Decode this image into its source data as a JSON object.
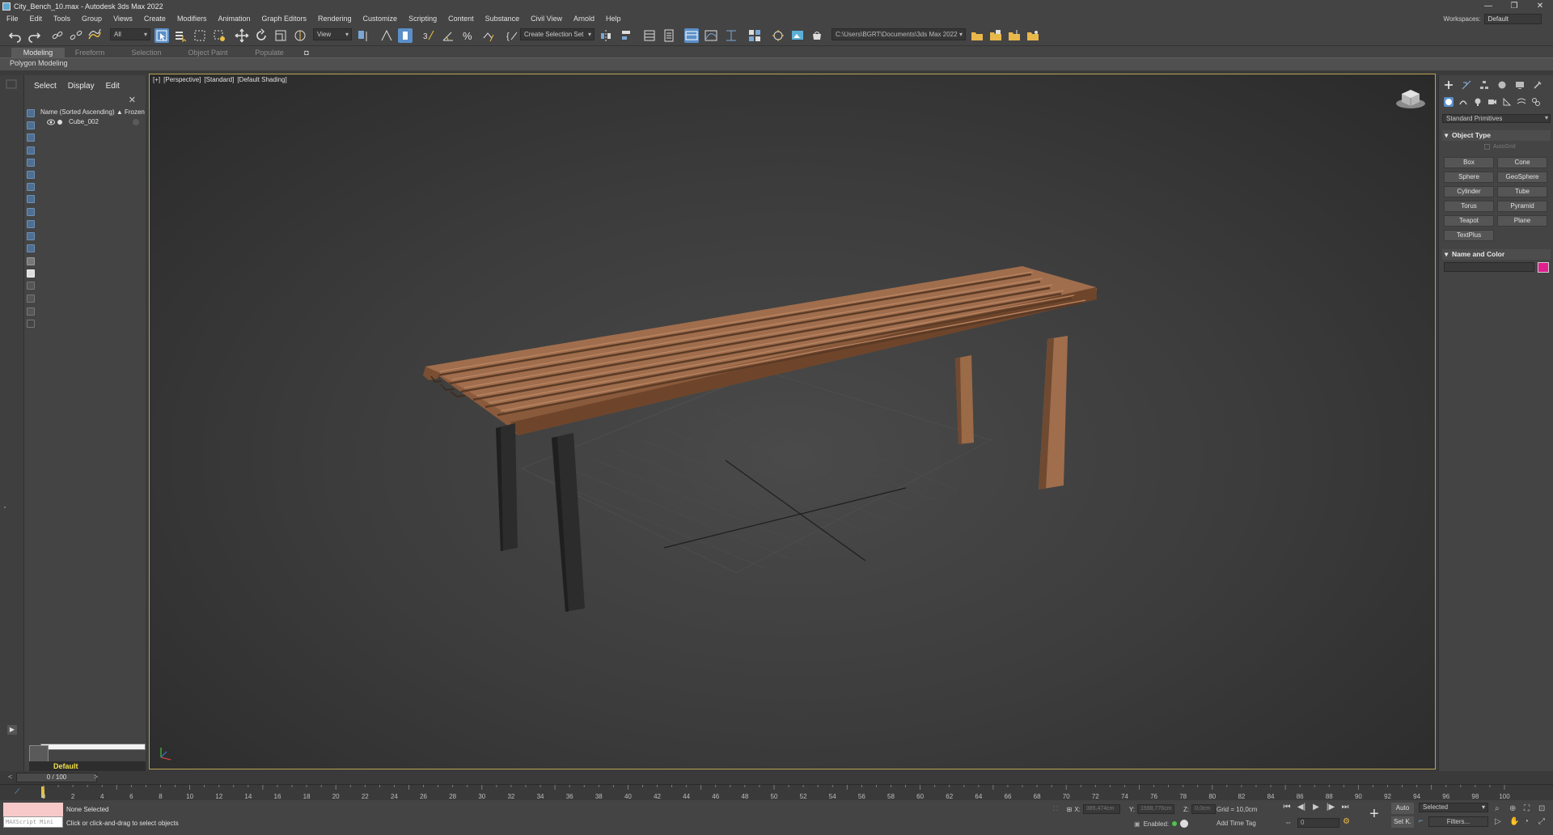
{
  "window": {
    "title": "City_Bench_10.max - Autodesk 3ds Max 2022",
    "controls": [
      "—",
      "❐",
      "✕"
    ]
  },
  "menu": [
    "File",
    "Edit",
    "Tools",
    "Group",
    "Views",
    "Create",
    "Modifiers",
    "Animation",
    "Graph Editors",
    "Rendering",
    "Customize",
    "Scripting",
    "Content",
    "Substance",
    "Civil View",
    "Arnold",
    "Help"
  ],
  "workspace": {
    "label": "Workspaces:",
    "value": "Default"
  },
  "toolbar": {
    "filter_value": "All",
    "refcoord_value": "View",
    "selection_set_placeholder": "Create Selection Set",
    "project_path": "C:\\Users\\BGRT\\Documents\\3ds Max 2022"
  },
  "ribbon": {
    "tabs": [
      "Modeling",
      "Freeform",
      "Selection",
      "Object Paint",
      "Populate"
    ],
    "active_tab": "Modeling",
    "panel_label": "Polygon Modeling"
  },
  "scene_explorer": {
    "tabs": [
      "Select",
      "Display",
      "Edit"
    ],
    "header": "Name (Sorted Ascending) ▲ Frozen",
    "objects": [
      {
        "name": "Cube_002"
      }
    ],
    "layer": "Default"
  },
  "viewport": {
    "labels": [
      "+",
      "Perspective",
      "Standard",
      "Default Shading"
    ]
  },
  "command_panel": {
    "dropdown": "Standard Primitives",
    "object_type_title": "Object Type",
    "autogrid": "AutoGrid",
    "primitives": [
      "Box",
      "Cone",
      "Sphere",
      "GeoSphere",
      "Cylinder",
      "Tube",
      "Torus",
      "Pyramid",
      "Teapot",
      "Plane",
      "TextPlus"
    ],
    "name_color_title": "Name and Color",
    "object_color": "#e0208f"
  },
  "time_slider": {
    "value": "0 / 100",
    "left_arrow": "<",
    "right_arrow": ">"
  },
  "track": {
    "ticks": [
      "0",
      "2",
      "4",
      "6",
      "8",
      "10",
      "12",
      "14",
      "16",
      "18",
      "20",
      "22",
      "24",
      "26",
      "28",
      "30",
      "32",
      "34",
      "36",
      "38",
      "40",
      "42",
      "44",
      "46",
      "48",
      "50",
      "52",
      "54",
      "56",
      "58",
      "60",
      "62",
      "64",
      "66",
      "68",
      "70",
      "72",
      "74",
      "76",
      "78",
      "80",
      "82",
      "84",
      "86",
      "88",
      "90",
      "92",
      "94",
      "96",
      "98",
      "100"
    ]
  },
  "status": {
    "maxscript": "MAXScript Mini",
    "selection": "None Selected",
    "prompt": "Click or click-and-drag to select objects",
    "x_label": "X:",
    "x_value": "385,474cm",
    "y_label": "Y:",
    "y_value": "1598,776cm",
    "z_label": "Z:",
    "z_value": "0,0cm",
    "grid": "Grid = 10,0cm",
    "enabled": "Enabled:",
    "add_time_tag": "Add Time Tag",
    "frame_value": "0",
    "auto": "Auto",
    "set_k": "Set K.",
    "key_filter": "Selected",
    "filters": "Filters..."
  }
}
